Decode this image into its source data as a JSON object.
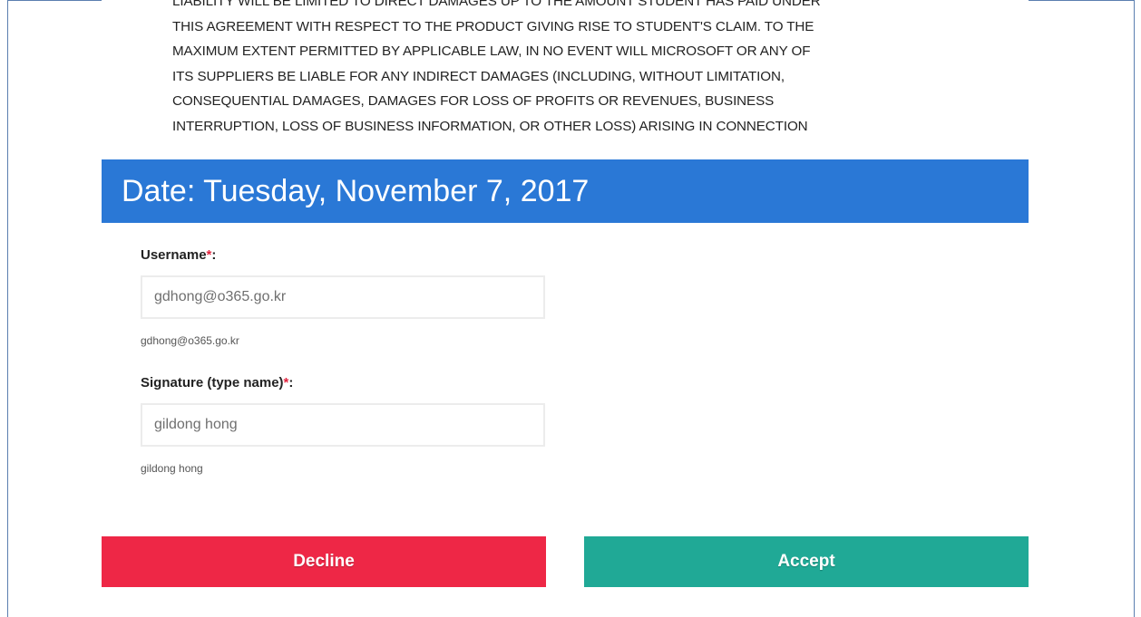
{
  "agreement": {
    "text": "LIABILITY WILL BE LIMITED TO DIRECT DAMAGES UP TO THE AMOUNT STUDENT HAS PAID UNDER\nTHIS AGREEMENT WITH RESPECT TO THE PRODUCT GIVING RISE TO STUDENT'S CLAIM. TO THE\nMAXIMUM EXTENT PERMITTED BY APPLICABLE LAW, IN NO EVENT WILL MICROSOFT OR ANY OF\nITS SUPPLIERS BE LIABLE FOR ANY INDIRECT DAMAGES (INCLUDING, WITHOUT LIMITATION,\nCONSEQUENTIAL DAMAGES, DAMAGES FOR LOSS OF PROFITS OR REVENUES, BUSINESS\nINTERRUPTION, LOSS OF BUSINESS INFORMATION, OR OTHER LOSS) ARISING IN CONNECTION",
    "scroll_down_icon": "arrow-down-icon"
  },
  "date_header": "Date: Tuesday, November 7, 2017",
  "form": {
    "username": {
      "label": "Username",
      "required_mark": "*",
      "suffix": ":",
      "value": "gdhong@o365.go.kr",
      "help": "gdhong@o365.go.kr"
    },
    "signature": {
      "label": "Signature (type name)",
      "required_mark": "*",
      "suffix": ":",
      "value": "gildong hong",
      "help": "gildong hong"
    }
  },
  "buttons": {
    "decline": "Decline",
    "accept": "Accept"
  },
  "colors": {
    "header_blue": "#2a78d6",
    "decline_red": "#ee2746",
    "accept_green": "#20a996",
    "required_red": "#e2233e"
  }
}
